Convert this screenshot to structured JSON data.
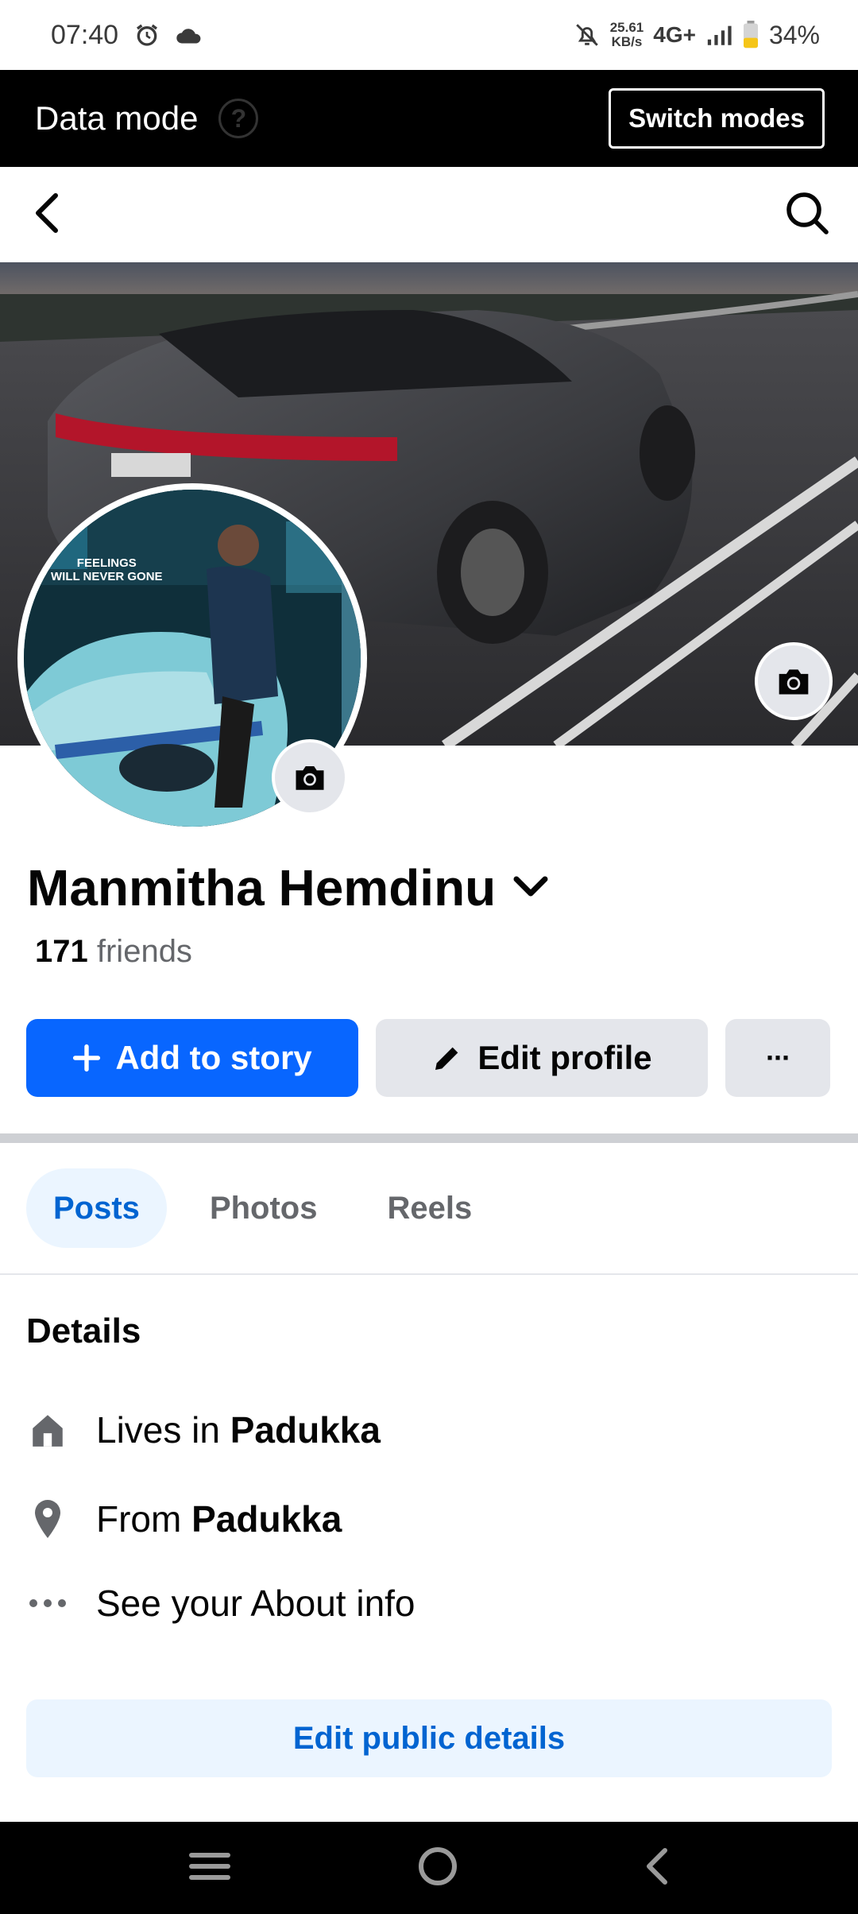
{
  "status_bar": {
    "time": "07:40",
    "net_speed_value": "25.61",
    "net_speed_unit": "KB/s",
    "network": "4G+",
    "battery": "34%",
    "icons": [
      "alarm-icon",
      "cloud-icon",
      "mute-icon",
      "signal-icon",
      "battery-icon"
    ]
  },
  "data_bar": {
    "title": "Data mode",
    "help_icon": "?",
    "switch_label": "Switch modes"
  },
  "nav": {
    "back_icon": "back-arrow-icon",
    "search_icon": "search-icon"
  },
  "profile": {
    "name": "Manmitha Hemdinu",
    "friends_count": "171",
    "friends_label": "friends",
    "avatar_overlay_line1": "FEELINGS",
    "avatar_overlay_line2": "WILL NEVER GONE"
  },
  "actions": {
    "add_story": "Add to story",
    "edit_profile": "Edit profile",
    "more": "···"
  },
  "tabs": [
    {
      "label": "Posts",
      "active": true
    },
    {
      "label": "Photos",
      "active": false
    },
    {
      "label": "Reels",
      "active": false
    }
  ],
  "details": {
    "title": "Details",
    "lives_prefix": "Lives in",
    "lives_place": "Padukka",
    "from_prefix": "From",
    "from_place": "Padukka",
    "about": "See your About info",
    "edit_public": "Edit public details"
  },
  "colors": {
    "primary": "#0866ff",
    "link": "#0064d1",
    "secondary_bg": "#e4e6eb",
    "tab_active_bg": "#ebf5ff"
  }
}
